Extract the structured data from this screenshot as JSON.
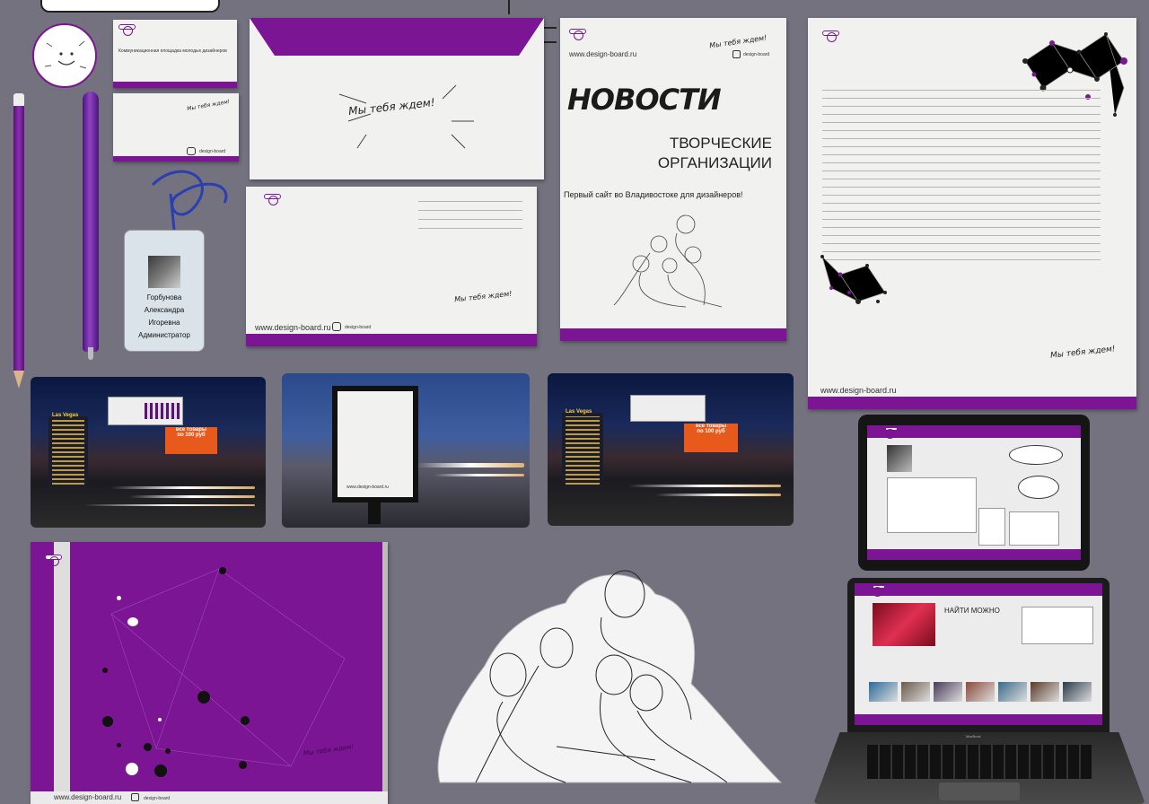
{
  "brand": {
    "url": "www.design-board.ru",
    "instagram": "design-board",
    "slogan": "Мы тебя ждем!",
    "business_card_text": "Коммуникационная площадка молодых дизайнеров"
  },
  "badge": {
    "line1": "Горбунова",
    "line2": "Александра",
    "line3": "Игоревна",
    "line4": "Администратор"
  },
  "poster": {
    "title": "НОВОСТИ",
    "subtitle1": "ТВОРЧЕСКИЕ",
    "subtitle2": "ОРГАНИЗАЦИИ",
    "tagline": "Первый сайт во Владивостоке для дизайнеров!"
  },
  "outdoor": {
    "billboard_orange1": "все товары",
    "billboard_orange2": "по 100 руб",
    "city_sign": "Las Vegas"
  },
  "laptop": {
    "find_label": "НАЙТИ МОЖНО",
    "brand_label": "MacBook"
  },
  "colors": {
    "accent": "#7b1593",
    "background": "#74727f",
    "paper": "#f1f1f0"
  }
}
